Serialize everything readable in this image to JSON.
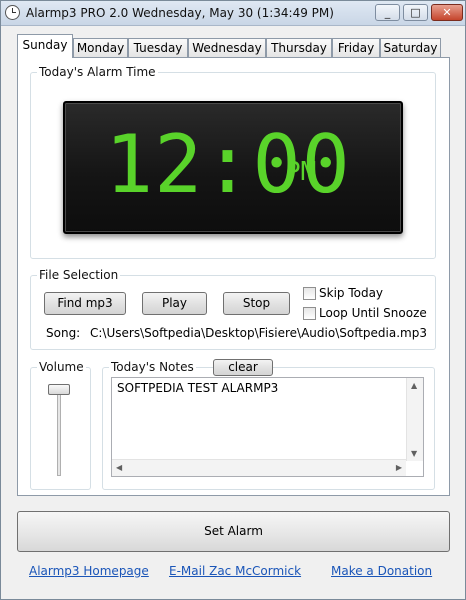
{
  "window": {
    "title": "Alarmp3 PRO 2.0  Wednesday, May 30  (1:34:49 PM)"
  },
  "tabs": [
    {
      "label": "Sunday",
      "active": true
    },
    {
      "label": "Monday"
    },
    {
      "label": "Tuesday"
    },
    {
      "label": "Wednesday"
    },
    {
      "label": "Thursday"
    },
    {
      "label": "Friday"
    },
    {
      "label": "Saturday"
    }
  ],
  "alarm_time": {
    "group_label": "Today's Alarm Time",
    "time": "12:00",
    "ampm": "PM",
    "digit_color": "#59d32a"
  },
  "file_selection": {
    "group_label": "File Selection",
    "find_label": "Find mp3",
    "play_label": "Play",
    "stop_label": "Stop",
    "skip_today_label": "Skip Today",
    "loop_label": "Loop Until Snooze",
    "song_label": "Song:",
    "song_path": "C:\\Users\\Softpedia\\Desktop\\Fisiere\\Audio\\Softpedia.mp3"
  },
  "volume": {
    "group_label": "Volume",
    "level": 1.0
  },
  "notes": {
    "group_label": "Today's Notes",
    "clear_label": "clear",
    "text": "SOFTPEDIA TEST ALARMP3"
  },
  "set_alarm_label": "Set Alarm",
  "links": {
    "homepage": "Alarmp3 Homepage",
    "email": "E-Mail Zac McCormick",
    "donate": "Make a Donation"
  }
}
